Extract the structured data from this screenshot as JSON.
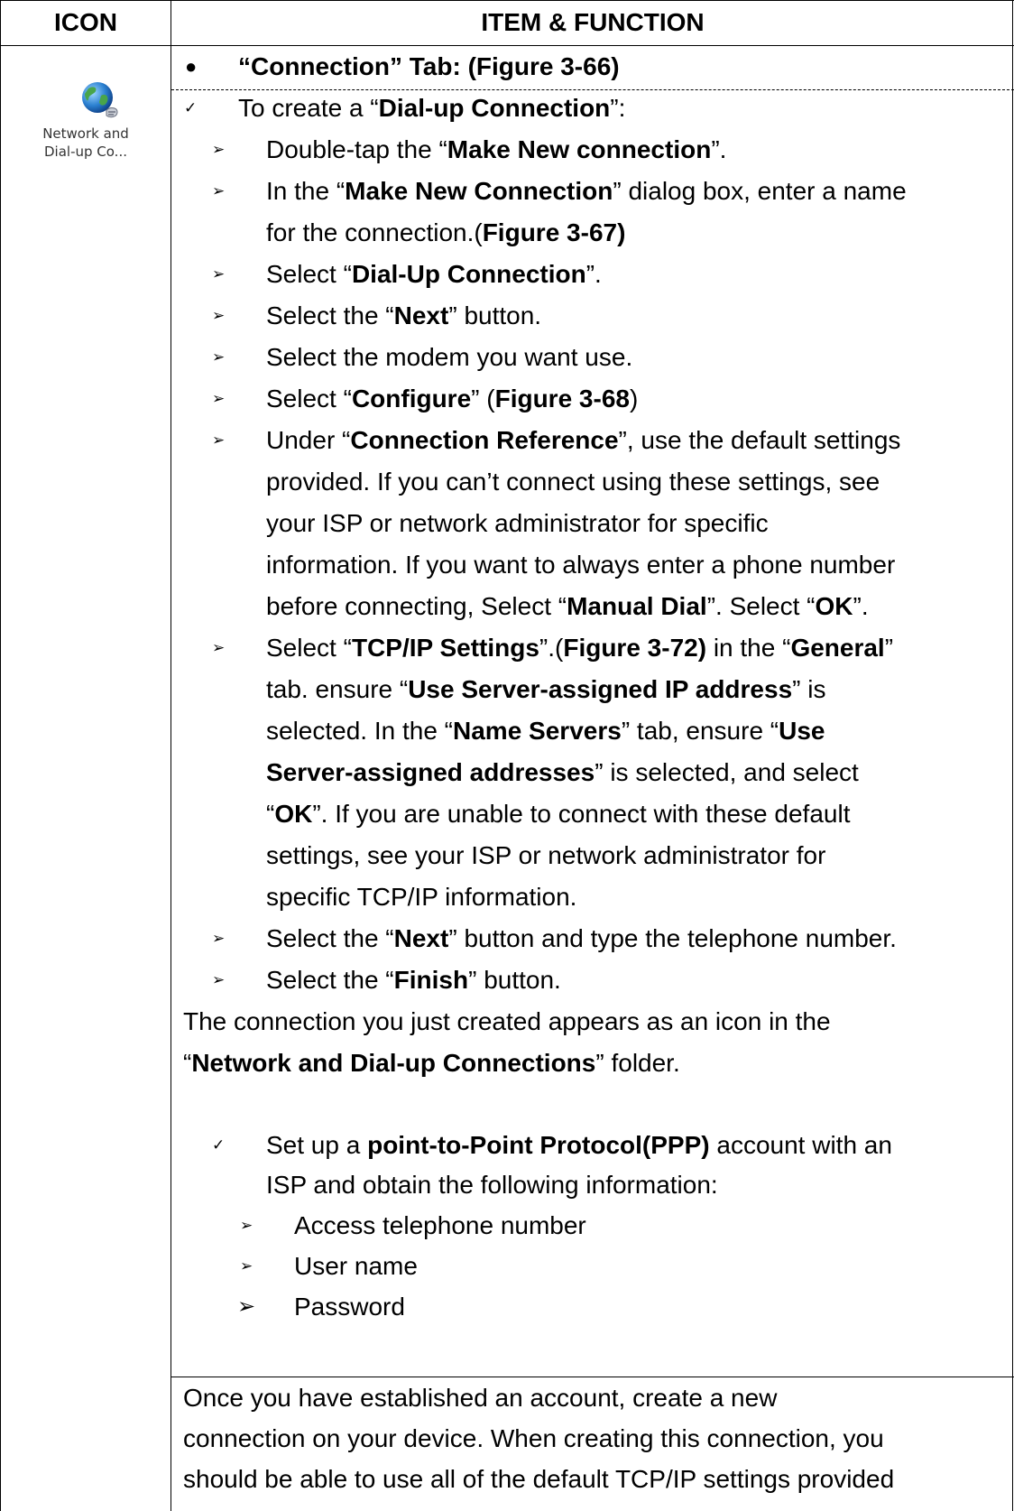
{
  "table": {
    "header": {
      "icon_col": "ICON",
      "item_col": "ITEM & FUNCTION"
    },
    "icon": {
      "name": "network-dialup-globe-icon",
      "caption_line1": "Network and",
      "caption_line2": "Dial-up Co..."
    }
  },
  "section_title": "“Connection” Tab: (Figure 3-66)",
  "lines": {
    "l1": [
      "To create a “",
      "Dial-up Connection",
      "”:"
    ],
    "l2": [
      "Double-tap the “",
      "Make New connection",
      "”."
    ],
    "l3": [
      "In the “",
      "Make New Connection",
      "” dialog box, enter a name"
    ],
    "l4": [
      "for the connection.(",
      "Figure 3-67)"
    ],
    "l5": [
      "Select “",
      "Dial-Up Connection",
      "”."
    ],
    "l6": [
      "Select the “",
      "Next",
      "” button."
    ],
    "l7": "Select the modem you want use.",
    "l8": [
      "Select “",
      "Configure",
      "” (",
      "Figure 3-68",
      ")"
    ],
    "l9": [
      "Under “",
      "Connection Reference",
      "”, use the default settings"
    ],
    "l10": "provided. If you can’t connect using these settings, see",
    "l11": "your ISP or network administrator for specific",
    "l12": "information. If you want to always enter a phone number",
    "l13": [
      "before connecting, Select “",
      "Manual Dial",
      "”. Select “",
      "OK",
      "”."
    ],
    "l14": [
      "Select “",
      "TCP/IP Settings",
      "”.(",
      "Figure 3-72)",
      " in the “",
      "General",
      "”"
    ],
    "l15": [
      "tab. ensure “",
      "Use Server-assigned IP address",
      "” is"
    ],
    "l16": [
      "selected. In the “",
      "Name Servers",
      "” tab, ensure “",
      "Use"
    ],
    "l17": [
      "Server-assigned addresses",
      "” is selected, and select"
    ],
    "l18": [
      "“",
      "OK",
      "”. If you are unable to connect with these default"
    ],
    "l19": "settings, see your ISP or network administrator for",
    "l20": "specific TCP/IP information.",
    "l21": [
      "Select the “",
      "Next",
      "” button and type the telephone number."
    ],
    "l22": [
      "Select the “",
      "Finish",
      "” button."
    ],
    "l23": "The connection you just created appears as an icon in the",
    "l24": [
      "“",
      "Network and Dial-up Connections",
      "” folder."
    ],
    "l25": [
      "Set up a ",
      "point-to-Point Protocol(PPP)",
      " account with an"
    ],
    "l26": "ISP and obtain the following information:",
    "l27": "Access telephone number",
    "l28": "User name",
    "l29": "Password",
    "l30": "Once you have established an account, create a new",
    "l31": "connection on your device. When creating this connection, you",
    "l32": "should be able to use all of the default TCP/IP settings provided"
  },
  "glyphs": {
    "dot": "●",
    "check": "✓",
    "arrow": "➢"
  }
}
